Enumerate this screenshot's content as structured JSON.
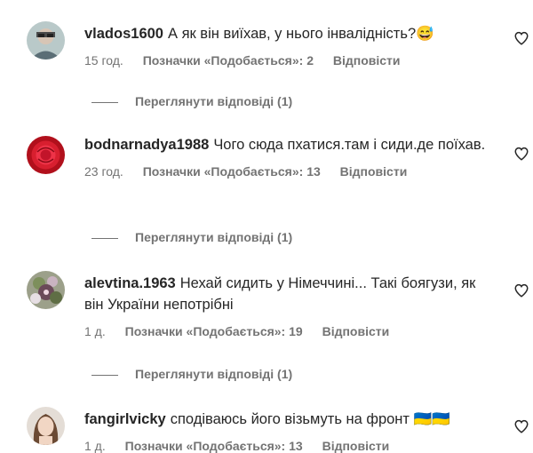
{
  "comments": [
    {
      "username": "vlados1600",
      "text": "А як він виїхав, у нього інвалідність?😅",
      "time": "15 год.",
      "likes": "Позначки «Подобається»: 2",
      "reply": "Відповісти",
      "view_replies": "Переглянути відповіді (1)",
      "avatar_icon": "user-avatar-glasses"
    },
    {
      "username": "bodnarnadya1988",
      "text": "Чого сюда пхатися.там і сиди.де поїхав.",
      "time": "23 год.",
      "likes": "Позначки «Подобається»: 13",
      "reply": "Відповісти",
      "view_replies": "Переглянути відповіді (1)",
      "avatar_icon": "user-avatar-rose"
    },
    {
      "username": "alevtina.1963",
      "text": "Нехай сидить у Німеччині... Такі боягузи, як він України непотрібні",
      "time": "1 д.",
      "likes": "Позначки «Подобається»: 19",
      "reply": "Відповісти",
      "view_replies": "Переглянути відповіді (1)",
      "avatar_icon": "user-avatar-flowers"
    },
    {
      "username": "fangirlvicky",
      "text": "сподіваюсь його візьмуть на фронт 🇺🇦🇺🇦",
      "time": "1 д.",
      "likes": "Позначки «Подобається»: 13",
      "reply": "Відповісти",
      "avatar_icon": "user-avatar-portrait"
    }
  ],
  "icons": {
    "like": "heart-outline-icon"
  },
  "colors": {
    "text_primary": "#262626",
    "text_secondary": "#737373",
    "background": "#ffffff"
  }
}
